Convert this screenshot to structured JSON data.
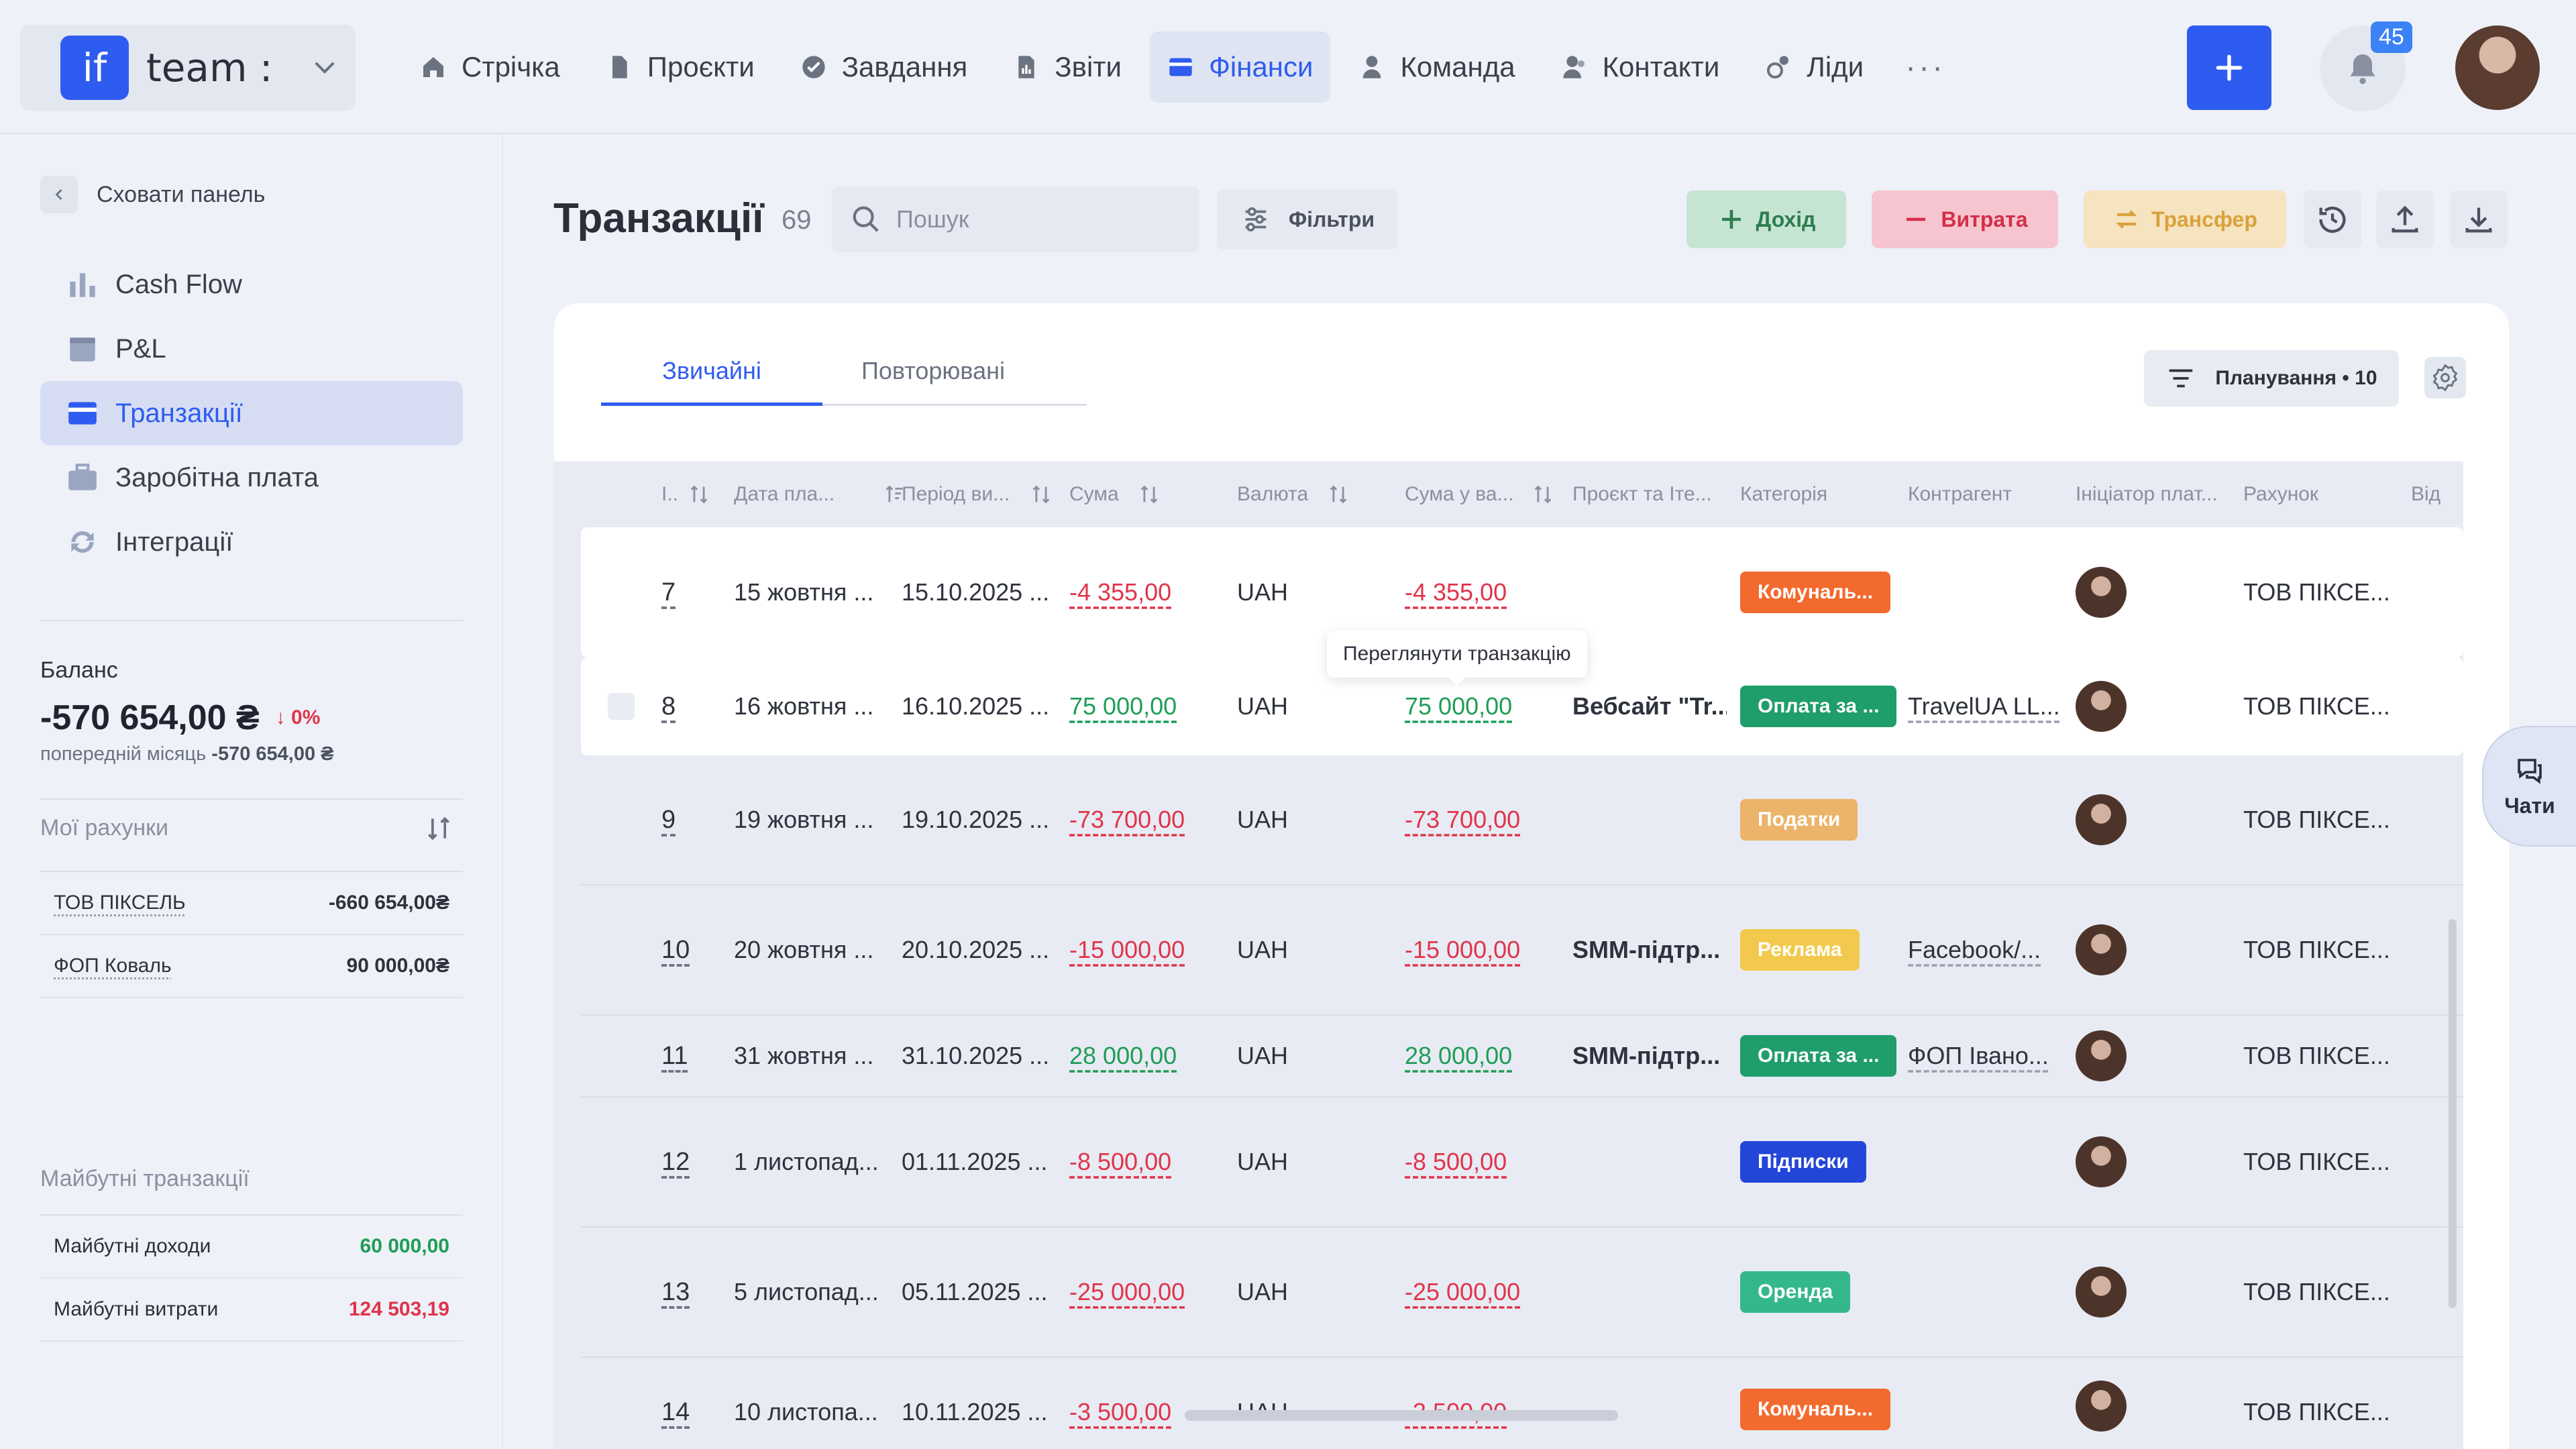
{
  "team": {
    "logo": "if",
    "name": "team :"
  },
  "nav": [
    {
      "label": "Стрічка"
    },
    {
      "label": "Проєкти"
    },
    {
      "label": "Завдання"
    },
    {
      "label": "Звіти"
    },
    {
      "label": "Фінанси"
    },
    {
      "label": "Команда"
    },
    {
      "label": "Контакти"
    },
    {
      "label": "Ліди"
    }
  ],
  "nav_more": "···",
  "notifications_count": "45",
  "sidebar": {
    "hide_label": "Сховати панель",
    "items": [
      {
        "label": "Cash Flow"
      },
      {
        "label": "P&L"
      },
      {
        "label": "Транзакції"
      },
      {
        "label": "Заробітна плата"
      },
      {
        "label": "Інтеграції"
      }
    ],
    "balance_label": "Баланс",
    "balance_value": "-570 654,00 ₴",
    "balance_change": "↓ 0%",
    "prev_label": "попередній місяць",
    "prev_value": "-570 654,00 ₴",
    "accounts_title": "Мої рахунки",
    "accounts": [
      {
        "name": "ТОВ ПІКСЕЛЬ",
        "value": "-660 654,00₴"
      },
      {
        "name": "ФОП Коваль",
        "value": "90 000,00₴"
      }
    ],
    "future_title": "Майбутні транзакції",
    "future": [
      {
        "name": "Майбутні доходи",
        "value": "60 000,00"
      },
      {
        "name": "Майбутні витрати",
        "value": "124 503,19"
      }
    ]
  },
  "page": {
    "title": "Транзакції",
    "count": "69"
  },
  "search": {
    "placeholder": "Пошук"
  },
  "buttons": {
    "filters": "Фільтри",
    "income": "Дохід",
    "expense": "Витрата",
    "transfer": "Трансфер"
  },
  "tabs": [
    {
      "label": "Звичайні"
    },
    {
      "label": "Повторювані"
    }
  ],
  "planning": "Планування • 10",
  "columns": [
    {
      "label": "І.."
    },
    {
      "label": "Дата пла..."
    },
    {
      "label": "Період ви..."
    },
    {
      "label": "Сума"
    },
    {
      "label": "Валюта"
    },
    {
      "label": "Сума у ва..."
    },
    {
      "label": "Проєкт та Іте..."
    },
    {
      "label": "Категорія"
    },
    {
      "label": "Контрагент"
    },
    {
      "label": "Ініціатор плат..."
    },
    {
      "label": "Рахунок"
    },
    {
      "label": "Від"
    }
  ],
  "rows": [
    {
      "num": "7",
      "date": "15 жовтня ...",
      "period": "15.10.2025 ...",
      "amount": "-4 355,00",
      "currency": "UAH",
      "amount_base": "-4 355,00",
      "project": "",
      "category": "Комуналь...",
      "cat_color": "#f26a2e",
      "contractor": "",
      "account": "ТОВ ПІКСЕ..."
    },
    {
      "num": "8",
      "date": "16 жовтня ...",
      "period": "16.10.2025 ...",
      "amount": "75 000,00",
      "currency": "UAH",
      "amount_base": "75 000,00",
      "project": "Вебсайт \"Tr...",
      "category": "Оплата за ...",
      "cat_color": "#1f9d6b",
      "contractor": "TravelUA LL...",
      "account": "ТОВ ПІКСЕ..."
    },
    {
      "num": "9",
      "date": "19 жовтня ...",
      "period": "19.10.2025 ...",
      "amount": "-73 700,00",
      "currency": "UAH",
      "amount_base": "-73 700,00",
      "project": "",
      "category": "Податки",
      "cat_color": "#ecb36a",
      "contractor": "",
      "account": "ТОВ ПІКСЕ..."
    },
    {
      "num": "10",
      "date": "20 жовтня ...",
      "period": "20.10.2025 ...",
      "amount": "-15 000,00",
      "currency": "UAH",
      "amount_base": "-15 000,00",
      "project": "SMM-підтр...",
      "category": "Реклама",
      "cat_color": "#f2c94c",
      "contractor": "Facebook/...",
      "account": "ТОВ ПІКСЕ..."
    },
    {
      "num": "11",
      "date": "31 жовтня ...",
      "period": "31.10.2025 ...",
      "amount": "28 000,00",
      "currency": "UAH",
      "amount_base": "28 000,00",
      "project": "SMM-підтр...",
      "category": "Оплата за ...",
      "cat_color": "#1f9d6b",
      "contractor": "ФОП Івано...",
      "account": "ТОВ ПІКСЕ..."
    },
    {
      "num": "12",
      "date": "1 листопад...",
      "period": "01.11.2025 ...",
      "amount": "-8 500,00",
      "currency": "UAH",
      "amount_base": "-8 500,00",
      "project": "",
      "category": "Підписки",
      "cat_color": "#2446d8",
      "contractor": "",
      "account": "ТОВ ПІКСЕ..."
    },
    {
      "num": "13",
      "date": "5 листопад...",
      "period": "05.11.2025 ...",
      "amount": "-25 000,00",
      "currency": "UAH",
      "amount_base": "-25 000,00",
      "project": "",
      "category": "Оренда",
      "cat_color": "#34b88a",
      "contractor": "",
      "account": "ТОВ ПІКСЕ..."
    },
    {
      "num": "14",
      "date": "10 листопа...",
      "period": "10.11.2025 ...",
      "amount": "-3 500,00",
      "currency": "UAH",
      "amount_base": "-3 500,00",
      "project": "",
      "category": "Комуналь...",
      "cat_color": "#f26a2e",
      "contractor": "",
      "account": "ТОВ ПІКСЕ..."
    }
  ],
  "tooltip": "Переглянути транзакцію",
  "chats_label": "Чати"
}
